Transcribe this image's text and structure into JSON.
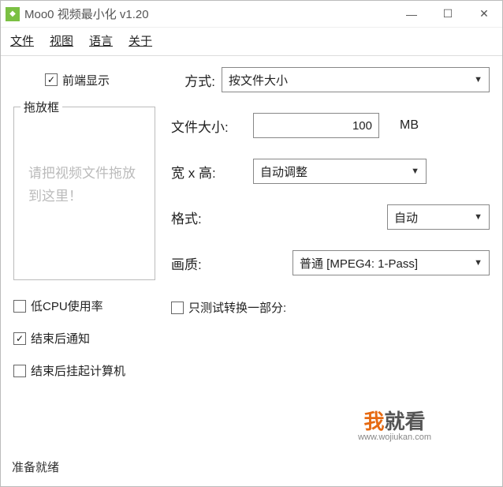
{
  "window": {
    "title": "Moo0 视频最小化 v1.20"
  },
  "menu": {
    "file": "文件",
    "view": "视图",
    "language": "语言",
    "about": "关于"
  },
  "options": {
    "always_on_top": "前端显示",
    "low_cpu": "低CPU使用率",
    "notify_done": "结束后通知",
    "suspend_done": "结束后挂起计算机",
    "test_portion": "只测试转换一部分:"
  },
  "labels": {
    "mode": "方式:",
    "filesize": "文件大小:",
    "wh": "宽 x 高:",
    "format": "格式:",
    "quality": "画质:",
    "unit_mb": "MB"
  },
  "values": {
    "mode": "按文件大小",
    "filesize": "100",
    "wh": "自动调整",
    "format": "自动",
    "quality": "普通  [MPEG4: 1-Pass]"
  },
  "dropzone": {
    "legend": "拖放框",
    "hint": "请把视频文件拖放到这里！"
  },
  "status": "准备就绪",
  "watermark": {
    "wo": "我",
    "rest": "就看",
    "url": "www.wojiukan.com"
  }
}
